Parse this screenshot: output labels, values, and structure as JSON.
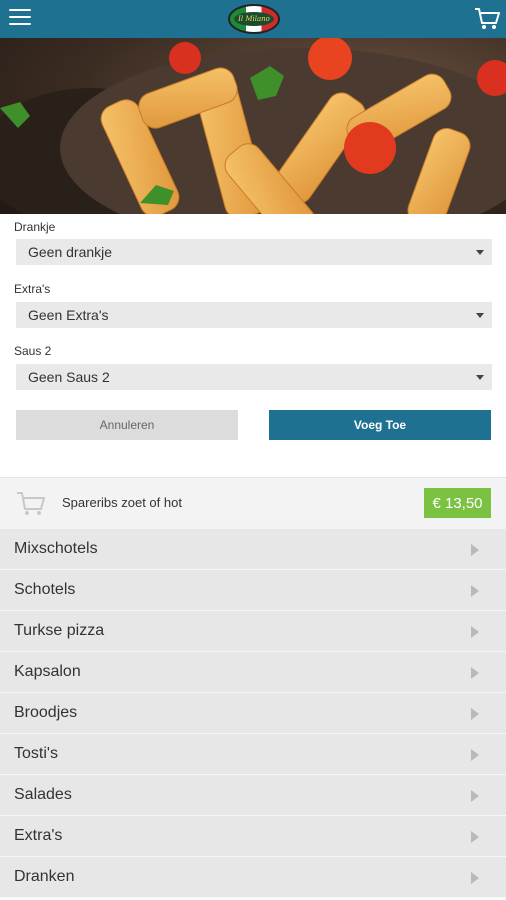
{
  "header": {
    "menu_icon": "hamburger-menu-icon",
    "logo_text": "Il Milano",
    "cart_icon": "shopping-cart-icon"
  },
  "hero": {
    "image": "penne-pasta-with-tomato-and-parsley"
  },
  "options": [
    {
      "label": "Drankje",
      "value": "Geen drankje"
    },
    {
      "label": "Extra's",
      "value": "Geen Extra's"
    },
    {
      "label": "Saus 2",
      "value": "Geen Saus 2"
    }
  ],
  "actions": {
    "cancel": "Annuleren",
    "add": "Voeg Toe"
  },
  "product": {
    "name": "Spareribs zoet of hot",
    "price": "€ 13,50"
  },
  "categories": [
    "Mixschotels",
    "Schotels",
    "Turkse pizza",
    "Kapsalon",
    "Broodjes",
    "Tosti's",
    "Salades",
    "Extra's",
    "Dranken"
  ],
  "colors": {
    "header": "#1f7191",
    "primary_button": "#1f7191",
    "price_badge": "#7cc242",
    "list_bg": "#e7e7e7"
  }
}
